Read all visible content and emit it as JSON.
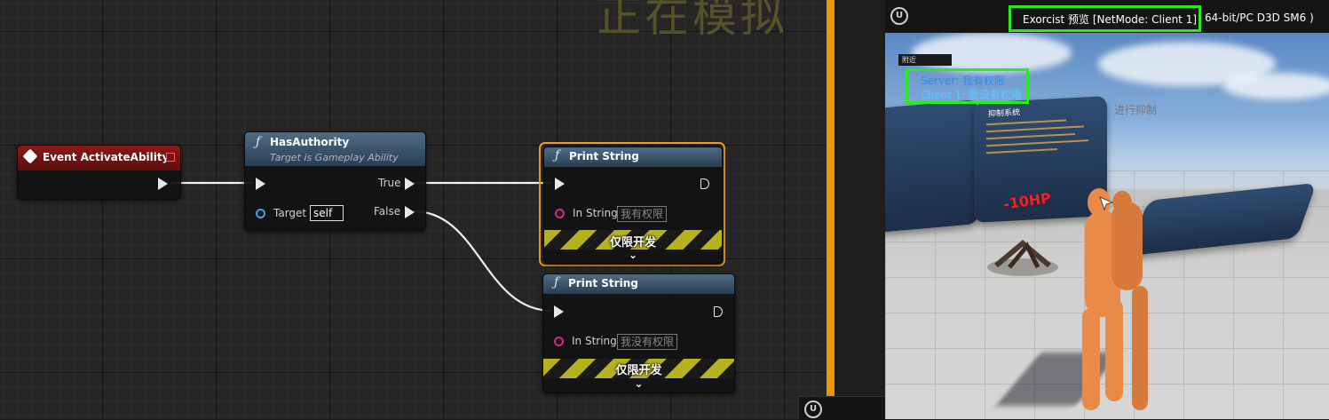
{
  "graph": {
    "watermark": "正在模拟",
    "nodes": {
      "event": {
        "title": "Event ActivateAbility"
      },
      "has_authority": {
        "title": "HasAuthority",
        "subtitle": "Target is Gameplay Ability",
        "true_label": "True",
        "false_label": "False",
        "target_label": "Target",
        "target_value": "self"
      },
      "print1": {
        "title": "Print String",
        "in_string_label": "In String",
        "in_string_value": "我有权限",
        "dev_only": "仅限开发"
      },
      "print2": {
        "title": "Print String",
        "in_string_label": "In String",
        "in_string_value": "我没有权限",
        "dev_only": "仅限开发"
      }
    }
  },
  "viewport": {
    "title": "Exorcist 预览 [NetMode: Client 1]",
    "title_suffix": "64-bit/PC D3D SM6 )",
    "mini_label": "附近",
    "debug": {
      "server_line": "Server: 我有权限",
      "client_line": "Client 1: 我没有权限"
    },
    "background_text": "进行抑制",
    "damage_text": "-10HP",
    "panel_title": "抑制系统"
  },
  "colors": {
    "accent": "#e8960a",
    "highlight_box": "#2bea1e",
    "event_header": "#8d1717",
    "function_header": "#4f6c86",
    "debug_text": "#5fc6ff"
  }
}
